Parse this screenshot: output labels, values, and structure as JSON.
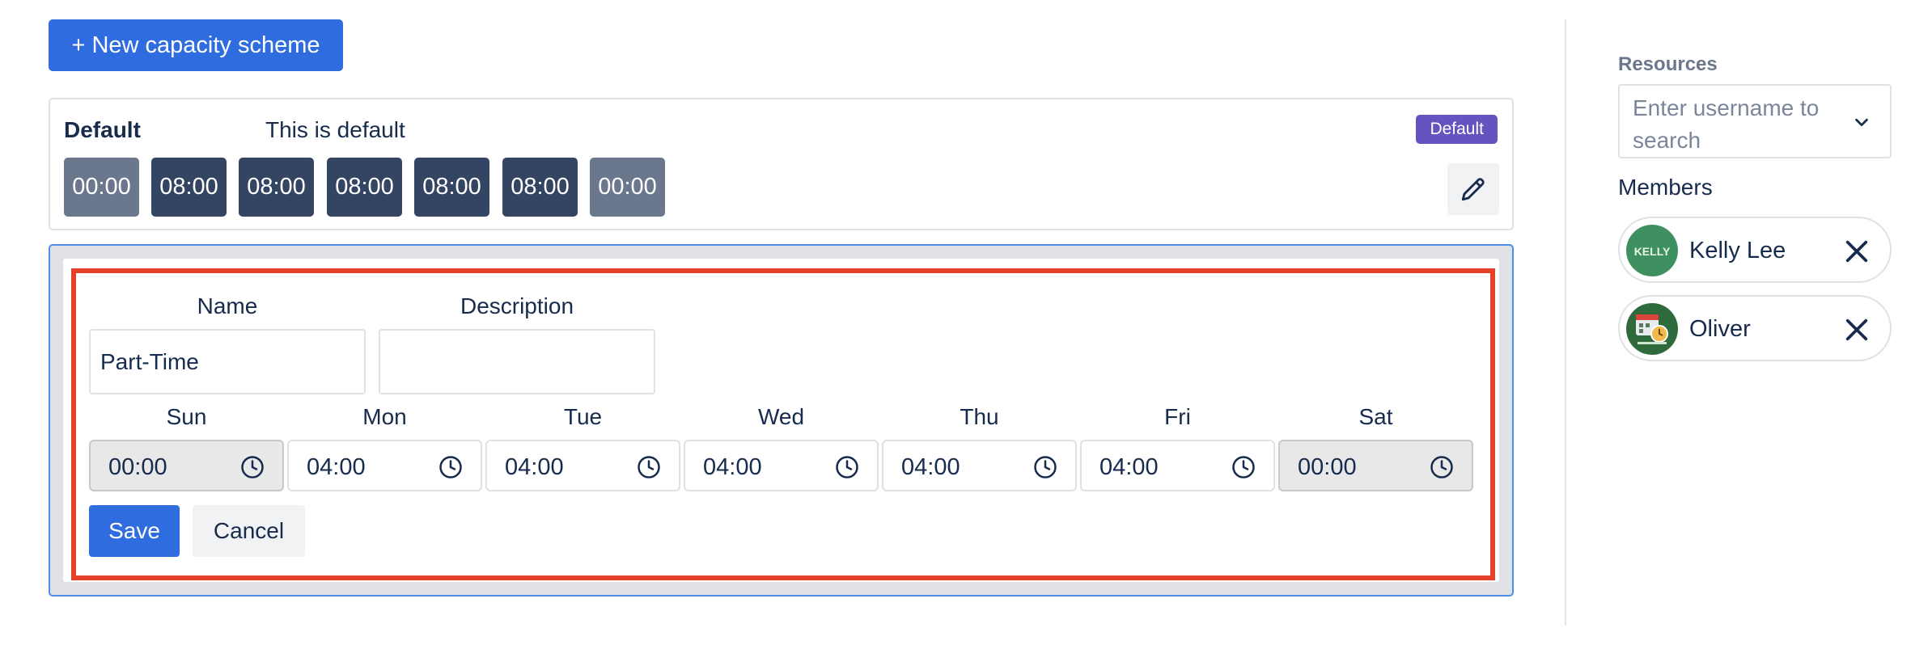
{
  "toolbar": {
    "new_scheme_label": "+ New capacity scheme"
  },
  "default_scheme": {
    "name": "Default",
    "description": "This is default",
    "badge": "Default",
    "days": [
      {
        "value": "00:00",
        "state": "off"
      },
      {
        "value": "08:00",
        "state": "work"
      },
      {
        "value": "08:00",
        "state": "work"
      },
      {
        "value": "08:00",
        "state": "work"
      },
      {
        "value": "08:00",
        "state": "work"
      },
      {
        "value": "08:00",
        "state": "work"
      },
      {
        "value": "00:00",
        "state": "off"
      }
    ],
    "edit_icon": "pencil-icon"
  },
  "editor": {
    "name_label": "Name",
    "name_value": "Part-Time",
    "description_label": "Description",
    "description_value": "",
    "days": [
      {
        "label": "Sun",
        "value": "00:00",
        "disabled": true
      },
      {
        "label": "Mon",
        "value": "04:00",
        "disabled": false
      },
      {
        "label": "Tue",
        "value": "04:00",
        "disabled": false
      },
      {
        "label": "Wed",
        "value": "04:00",
        "disabled": false
      },
      {
        "label": "Thu",
        "value": "04:00",
        "disabled": false
      },
      {
        "label": "Fri",
        "value": "04:00",
        "disabled": false
      },
      {
        "label": "Sat",
        "value": "00:00",
        "disabled": true
      }
    ],
    "save_label": "Save",
    "cancel_label": "Cancel",
    "clock_icon": "clock-icon"
  },
  "sidebar": {
    "resources_label": "Resources",
    "resources_placeholder": "Enter username to search",
    "members_label": "Members",
    "members": [
      {
        "name": "Kelly Lee",
        "avatar_text": "KELLY",
        "avatar_icon": "avatar-kelly"
      },
      {
        "name": "Oliver",
        "avatar_icon": "avatar-calendar-clock"
      }
    ]
  },
  "colors": {
    "primary": "#2f6cdf",
    "dark_chip": "#344563",
    "muted_chip": "#6b778c",
    "badge": "#6554c0",
    "highlight": "#e5402a"
  }
}
